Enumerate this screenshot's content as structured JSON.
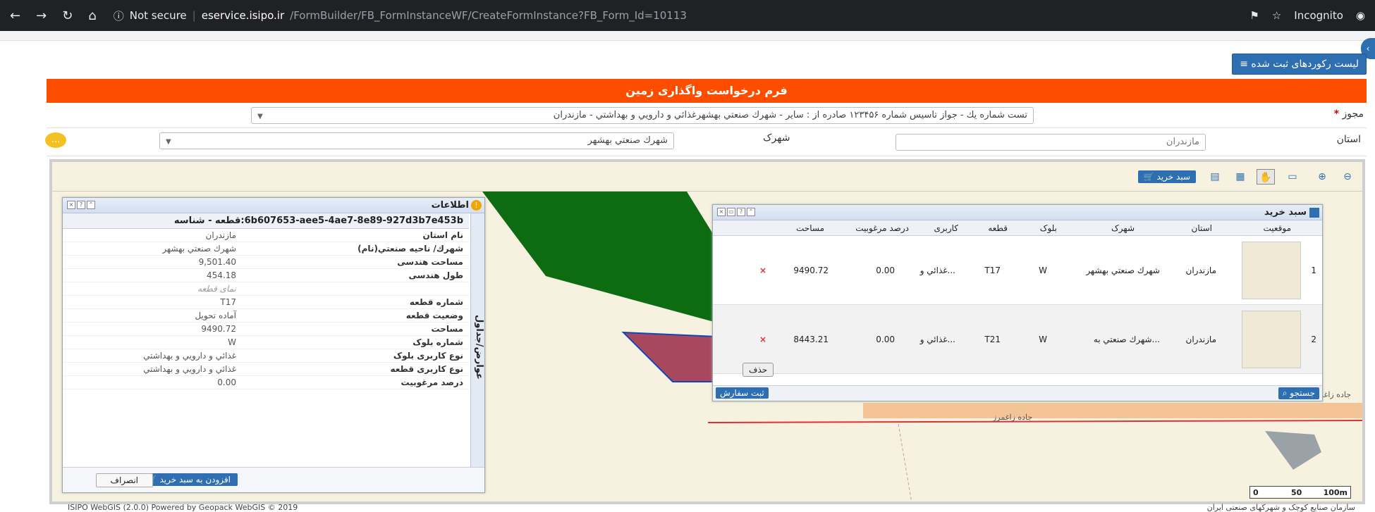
{
  "browser": {
    "security": "Not secure",
    "host": "eservice.isipo.ir",
    "path": "/FormBuilder/FB_FormInstanceWF/CreateFormInstance?FB_Form_Id=10113",
    "mode": "Incognito",
    "icons": [
      "back-icon",
      "forward-icon",
      "reload-icon",
      "home-icon",
      "info-icon",
      "extension-icon",
      "star-icon",
      "incognito-icon"
    ]
  },
  "header": {
    "records_button": "ليست ركوردهاى ثبت شده",
    "form_title": "فرم درخواست واگذاری زمین"
  },
  "form": {
    "permit_label": "مجوز",
    "permit_value": "تست شماره يك - جواز تاسيس شماره ١٢٣۴۵۶ صادره از : ساير - شهرك صنعتي بهشهرغذائي و دارويي و بهداشتي - مازندران",
    "province_label": "استان",
    "province_value": "مازندران",
    "town_label": "شهرک",
    "town_value": "شهرك صنعتي بهشهر"
  },
  "toolbar": {
    "cart_label": "سبد خرید"
  },
  "info_panel": {
    "title": "اطلاعات",
    "vtab": "عوارض/جداول",
    "id_row": "6b607653-aee5-4ae7-8e89-927d3b7e453b:قطعه - شناسه",
    "rows": [
      {
        "k": "نام استان",
        "v": "مازندران"
      },
      {
        "k": "شهرك/ ناحيه صنعتي(نام)",
        "v": "شهرك صنعتي بهشهر"
      },
      {
        "k": "مساحت هندسی",
        "v": "9,501.40"
      },
      {
        "k": "طول هندسی",
        "v": "454.18"
      },
      {
        "k": "",
        "v": "نمای قطعه"
      },
      {
        "k": "شماره قطعه",
        "v": "T17"
      },
      {
        "k": "وضعیت قطعه",
        "v": "آماده تحويل"
      },
      {
        "k": "مساحت",
        "v": "9490.72"
      },
      {
        "k": "شماره بلوک",
        "v": "W"
      },
      {
        "k": "نوع کاربری بلوک",
        "v": "غذائي و دارويي و بهداشتي"
      },
      {
        "k": "نوع کاربری قطعه",
        "v": "غذائي و دارويي و بهداشتي"
      },
      {
        "k": "درصد مرغوبیت",
        "v": "0.00"
      }
    ],
    "add_button": "افزودن به سبد خريد",
    "cancel_button": "انصراف"
  },
  "cart_panel": {
    "title": "سبد خريد",
    "columns": [
      "موقعیت",
      "استان",
      "شهرک",
      "بلوک",
      "قطعه",
      "کاربری",
      "درصد مرغوبیت",
      "مساحت"
    ],
    "rows": [
      {
        "n": "1",
        "province": "مازندران",
        "town": "شهرك صنعتي بهشهر",
        "block": "W",
        "plot": "T17",
        "use": "غذائي و...",
        "quality": "0.00",
        "area": "9490.72",
        "del": "×"
      },
      {
        "n": "2",
        "province": "مازندران",
        "town": "شهرك صنعتي به...",
        "block": "W",
        "plot": "T21",
        "use": "غذائي و...",
        "quality": "0.00",
        "area": "8443.21",
        "del": "×"
      }
    ],
    "delete_button": "حذف",
    "order_button": "ثبت سفارش",
    "search_button": "جستجو"
  },
  "map": {
    "road_label": "جاده زاغمرز",
    "scale": [
      "0",
      "50",
      "100m"
    ]
  },
  "footer": {
    "left": "ISIPO WebGIS (2.0.0) Powered by Geopack WebGIS © 2019",
    "right": "سازمان صنایع کوچک و شهرکهای صنعتی ایران"
  }
}
